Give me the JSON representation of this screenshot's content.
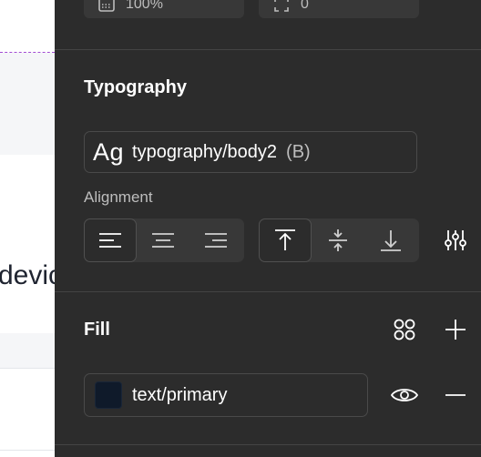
{
  "layout_top": {
    "zoom_value": "100%",
    "size_value": "0"
  },
  "typography": {
    "title": "Typography",
    "style_prefix": "Ag",
    "style_name": "typography/body2",
    "style_suffix": "(B)",
    "alignment_label": "Alignment",
    "horizontal_selected": "left",
    "vertical_selected": "top"
  },
  "fill": {
    "title": "Fill",
    "color_name": "text/primary",
    "swatch_color": "#0f1a2a"
  },
  "canvas": {
    "partial_text": "devic"
  }
}
